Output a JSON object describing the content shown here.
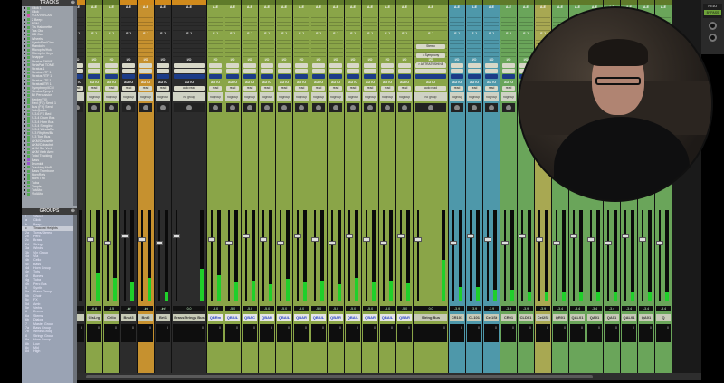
{
  "tracks_panel": {
    "title": "TRACKS",
    "items": [
      {
        "name": "Click 1",
        "color": "#5a5"
      },
      {
        "name": "Click",
        "color": "#5a5"
      },
      {
        "name": "VOX/VO/CAS",
        "color": "#c5a"
      },
      {
        "name": "2 Beep",
        "color": "#5a5"
      },
      {
        "name": "BPM",
        "color": "#5a5"
      },
      {
        "name": "Tls Hakonette",
        "color": "#5a5"
      },
      {
        "name": "Tas Olo",
        "color": "#5a5"
      },
      {
        "name": "HD Cart",
        "color": "#5a5"
      },
      {
        "name": "Wheels",
        "color": "#5a5"
      },
      {
        "name": "Cymb/Rm/Chm",
        "color": "#5a5"
      },
      {
        "name": "Mandolin",
        "color": "#5a5"
      },
      {
        "name": "Microphn/Hck",
        "color": "#5a5"
      },
      {
        "name": "Microphn Keys",
        "color": "#5a5"
      },
      {
        "name": "Snapper",
        "color": "#5a5"
      },
      {
        "name": "Stratus SHINE",
        "color": "#5a5"
      },
      {
        "name": "StrtaPad TOME",
        "color": "#5a5"
      },
      {
        "name": "Stratus 1",
        "color": "#5a5"
      },
      {
        "name": "Stratus LTF 1",
        "color": "#5a5"
      },
      {
        "name": "Stratus RTF 1",
        "color": "#5a5"
      },
      {
        "name": "Stratus LTF 1",
        "color": "#5a5"
      },
      {
        "name": "StratusRTR 1",
        "color": "#5a5"
      },
      {
        "name": "Symphnny/ICM",
        "color": "#5a5"
      },
      {
        "name": "Stratus Tymp 1",
        "color": "#5a5"
      },
      {
        "name": "Bil Percussion",
        "color": "#5a5"
      },
      {
        "name": "Kepler(FX)",
        "color": "#5a5"
      },
      {
        "name": "Red (FX) Send 1",
        "color": "#5a5"
      },
      {
        "name": "Bus (FX) Send",
        "color": "#5a5"
      },
      {
        "name": "SubQuake",
        "color": "#5a5"
      },
      {
        "name": "S.3.6 FX Bed",
        "color": "#5a5"
      },
      {
        "name": "S.3.4 Drum Bus",
        "color": "#5a5"
      },
      {
        "name": "S.3.4 Horn Bus",
        "color": "#5a5"
      },
      {
        "name": "S.3.4 Strngline",
        "color": "#5a5"
      },
      {
        "name": "S.3.4 Winds/Bs",
        "color": "#5a5"
      },
      {
        "name": "S.3 Rhythm/Bs",
        "color": "#5a5"
      },
      {
        "name": "S.3 Tom Bus",
        "color": "#5a5"
      },
      {
        "name": "AKM/Cmusette",
        "color": "#5a5"
      },
      {
        "name": "AKM/Cobachet",
        "color": "#5a5"
      },
      {
        "name": "AKM Ser Verb",
        "color": "#5a5"
      },
      {
        "name": "AKM Verb Amb",
        "color": "#5a5"
      },
      {
        "name": "Total Tracking",
        "color": "#5a5"
      },
      {
        "name": "Bass",
        "color": "#95c"
      },
      {
        "name": "Drumkit",
        "color": "#95c"
      },
      {
        "name": "Tracking MnB",
        "color": "#5a5"
      },
      {
        "name": "Bass Trombone",
        "color": "#5a5"
      },
      {
        "name": "HornRefs",
        "color": "#5a5"
      },
      {
        "name": "Horn Trio",
        "color": "#5a5"
      },
      {
        "name": "Tuba",
        "color": "#5a5"
      },
      {
        "name": "Timple",
        "color": "#5a5"
      },
      {
        "name": "TutAlto",
        "color": "#5a5"
      },
      {
        "name": "ViolAlto",
        "color": "#5a5"
      }
    ]
  },
  "groups_panel": {
    "title": "GROUPS",
    "items": [
      {
        "id": "!",
        "name": "<ALL>",
        "selected": false
      },
      {
        "id": "a",
        "name": "Click",
        "selected": false
      },
      {
        "id": "b",
        "name": "Beep",
        "selected": false
      },
      {
        "id": "c",
        "name": "Tinacoat Heights",
        "selected": true
      },
      {
        "id": "2a",
        "name": "Toms/Stereo",
        "selected": false
      },
      {
        "id": "2b",
        "name": "Perc",
        "selected": false
      },
      {
        "id": "2c",
        "name": "Brass",
        "selected": false
      },
      {
        "id": "2d",
        "name": "Strings",
        "selected": false
      },
      {
        "id": "3a",
        "name": "Winds",
        "selected": false
      },
      {
        "id": "3b",
        "name": "Vln Group",
        "selected": false
      },
      {
        "id": "4a",
        "name": "Vla",
        "selected": false
      },
      {
        "id": "4b",
        "name": "Cello",
        "selected": false
      },
      {
        "id": "4c",
        "name": "Bass",
        "selected": false
      },
      {
        "id": "4d",
        "name": "Horn Group",
        "selected": false
      },
      {
        "id": "4e",
        "name": "Tpts",
        "selected": false
      },
      {
        "id": "4f",
        "name": "Bones",
        "selected": false
      },
      {
        "id": "4g",
        "name": "Tuba",
        "selected": false
      },
      {
        "id": "4h",
        "name": "Perc Bus",
        "selected": false
      },
      {
        "id": "5",
        "name": "Synth",
        "selected": false
      },
      {
        "id": "5a",
        "name": "Piano Group",
        "selected": false
      },
      {
        "id": "5b",
        "name": "Choir",
        "selected": false
      },
      {
        "id": "5c",
        "name": "FX",
        "selected": false
      },
      {
        "id": "5d",
        "name": "Amb",
        "selected": false
      },
      {
        "id": "5e",
        "name": "Verbs",
        "selected": false
      },
      {
        "id": "6",
        "name": "Drums",
        "selected": false
      },
      {
        "id": "6a",
        "name": "Stems",
        "selected": false
      },
      {
        "id": "6b",
        "name": "Dialog",
        "selected": false
      },
      {
        "id": "7",
        "name": "Master Group",
        "selected": false
      },
      {
        "id": "7a",
        "name": "Bass Group",
        "selected": false
      },
      {
        "id": "7b",
        "name": "Winds Group",
        "selected": false
      },
      {
        "id": "8",
        "name": "Strings Group",
        "selected": false
      },
      {
        "id": "8a",
        "name": "Horn Group",
        "selected": false
      },
      {
        "id": "8b",
        "name": "Low",
        "selected": false
      },
      {
        "id": "8c",
        "name": "Mid",
        "selected": false
      },
      {
        "id": "8d",
        "name": "High",
        "selected": false
      }
    ]
  },
  "mixer": {
    "io_label": "I/O",
    "auto_label": "AUTO",
    "insert_a_label": "A-E",
    "insert_f_label": "F-J",
    "strips": [
      {
        "name": "",
        "kind": "dark",
        "wide": 0,
        "auto": "read",
        "group": "",
        "val": "",
        "plain": true,
        "meter": 0
      },
      {
        "name": "ClsLrg",
        "kind": "green",
        "wide": 0,
        "auto": "read",
        "group": "nogroup",
        "val": "-6.6",
        "plain": true,
        "meter": 0.3
      },
      {
        "name": "Cello",
        "kind": "green",
        "wide": 0,
        "auto": "read",
        "group": "nogroup",
        "val": "-4.5",
        "plain": true,
        "meter": 0.25
      },
      {
        "name": "Bnst3",
        "kind": "dark",
        "wide": 0,
        "auto": "read",
        "group": "nogroup",
        "val": "-inf",
        "plain": true,
        "meter": 0.2
      },
      {
        "name": "Bnt2",
        "kind": "orange",
        "wide": 0,
        "auto": "read",
        "group": "nogroup",
        "val": "-inf",
        "plain": true,
        "meter": 0.25
      },
      {
        "name": "Brt1",
        "kind": "dark",
        "wide": 0,
        "auto": "read",
        "group": "nogroup",
        "val": "-inf",
        "plain": true,
        "meter": 0.1
      },
      {
        "name": "BrassStrings Bus",
        "kind": "dark",
        "wide": 1,
        "auto": "auto read",
        "group": "no group",
        "val": "0.0",
        "plain": true,
        "meter": 0.35
      },
      {
        "name": "QBRm",
        "kind": "green",
        "wide": 0,
        "auto": "read",
        "group": "nogroup",
        "val": "-5.0",
        "plain": false,
        "meter": 0.28
      },
      {
        "name": "QBAIL",
        "kind": "green",
        "wide": 0,
        "auto": "read",
        "group": "nogroup",
        "val": "-5.0",
        "plain": false,
        "meter": 0.2
      },
      {
        "name": "QBAC",
        "kind": "green",
        "wide": 0,
        "auto": "read",
        "group": "nogroup",
        "val": "-5.0",
        "plain": false,
        "meter": 0.22
      },
      {
        "name": "QBAR",
        "kind": "green",
        "wide": 0,
        "auto": "read",
        "group": "nogroup",
        "val": "-5.0",
        "plain": false,
        "meter": 0.18
      },
      {
        "name": "QBAIL",
        "kind": "green",
        "wide": 0,
        "auto": "read",
        "group": "nogroup",
        "val": "-5.0",
        "plain": false,
        "meter": 0.24
      },
      {
        "name": "QBAR",
        "kind": "green",
        "wide": 0,
        "auto": "read",
        "group": "nogroup",
        "val": "-5.0",
        "plain": false,
        "meter": 0.2
      },
      {
        "name": "QBAIL",
        "kind": "green",
        "wide": 0,
        "auto": "read",
        "group": "nogroup",
        "val": "-5.0",
        "plain": false,
        "meter": 0.22
      },
      {
        "name": "QBAR",
        "kind": "green",
        "wide": 0,
        "auto": "read",
        "group": "nogroup",
        "val": "-5.0",
        "plain": false,
        "meter": 0.18
      },
      {
        "name": "QBAIL",
        "kind": "green",
        "wide": 0,
        "auto": "read",
        "group": "nogroup",
        "val": "-5.0",
        "plain": false,
        "meter": 0.25
      },
      {
        "name": "QBAR",
        "kind": "green",
        "wide": 0,
        "auto": "read",
        "group": "nogroup",
        "val": "-5.0",
        "plain": false,
        "meter": 0.2
      },
      {
        "name": "QBAIL",
        "kind": "green",
        "wide": 0,
        "auto": "read",
        "group": "nogroup",
        "val": "-5.0",
        "plain": false,
        "meter": 0.22
      },
      {
        "name": "QBAR",
        "kind": "green",
        "wide": 0,
        "auto": "read",
        "group": "nogroup",
        "val": "-5.0",
        "plain": false,
        "meter": 0.19
      },
      {
        "name": "String Bus",
        "kind": "green",
        "wide": 1,
        "auto": "auto read",
        "group": "no group",
        "val": "0.0",
        "plain": true,
        "meter": 0.45
      },
      {
        "name": "CR101",
        "kind": "teal",
        "wide": 0,
        "auto": "read",
        "group": "nogroup",
        "val": "-3.9",
        "plain": true,
        "meter": 0.15
      },
      {
        "name": "CL101",
        "kind": "teal",
        "wide": 0,
        "auto": "read",
        "group": "nogroup",
        "val": "-3.9",
        "plain": true,
        "meter": 0.15
      },
      {
        "name": "Cel1St",
        "kind": "teal",
        "wide": 0,
        "auto": "read",
        "group": "nogroup",
        "val": "-3.9",
        "plain": true,
        "meter": 0.12
      },
      {
        "name": "CR01",
        "kind": "lgreen",
        "wide": 0,
        "auto": "read",
        "group": "nogroup",
        "val": "-3.9",
        "plain": true,
        "meter": 0.12
      },
      {
        "name": "CLD01",
        "kind": "lgreen",
        "wide": 0,
        "auto": "read",
        "group": "nogroup",
        "val": "-3.9",
        "plain": true,
        "meter": 0.1
      },
      {
        "name": "Cel2St",
        "kind": "olive",
        "wide": 0,
        "auto": "read",
        "group": "nogroup",
        "val": "-3.9",
        "plain": true,
        "meter": 0.1
      },
      {
        "name": "QR01",
        "kind": "lgreen",
        "wide": 0,
        "auto": "read",
        "group": "nogroup",
        "val": "-3.4",
        "plain": true,
        "meter": 0.1
      },
      {
        "name": "QAL01",
        "kind": "lgreen",
        "wide": 0,
        "auto": "read",
        "group": "nogroup",
        "val": "-3.4",
        "plain": true,
        "meter": 0.1
      },
      {
        "name": "QA01",
        "kind": "lgreen",
        "wide": 0,
        "auto": "read",
        "group": "nogroup",
        "val": "-3.4",
        "plain": true,
        "meter": 0.1
      },
      {
        "name": "QA01",
        "kind": "lgreen",
        "wide": 0,
        "auto": "read",
        "group": "nogroup",
        "val": "-3.4",
        "plain": true,
        "meter": 0.1
      },
      {
        "name": "QAL01",
        "kind": "lgreen",
        "wide": 0,
        "auto": "read",
        "group": "nogroup",
        "val": "-3.4",
        "plain": true,
        "meter": 0.1
      },
      {
        "name": "QA01",
        "kind": "lgreen",
        "wide": 0,
        "auto": "read",
        "group": "nogroup",
        "val": "-3.4",
        "plain": true,
        "meter": 0.1
      },
      {
        "name": "Q",
        "kind": "lgreen",
        "wide": 0,
        "auto": "read",
        "group": "nogroup",
        "val": "-3.4",
        "plain": true,
        "meter": 0.1
      }
    ],
    "string_bus_inserts": [
      "Stereo",
      "> Symphony",
      "> ASTRATUSHINE"
    ]
  },
  "heat_panel": {
    "title": "HEAT",
    "bypass_label": "BYPASS"
  },
  "colors": {
    "green": "#8aa548",
    "lgreen": "#6aa55a",
    "dark": "#2c2c2c",
    "orange": "#c6912f",
    "teal": "#4e98aa",
    "olive": "#a8a852"
  }
}
